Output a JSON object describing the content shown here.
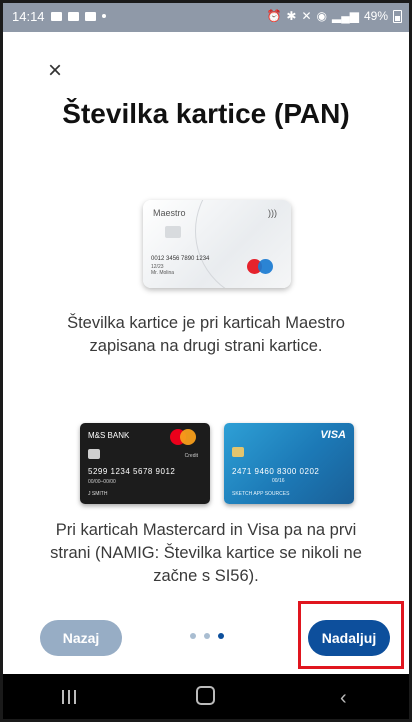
{
  "status_bar": {
    "time": "14:14",
    "battery": "49%"
  },
  "header": {
    "close_symbol": "×",
    "title": "Številka kartice (PAN)"
  },
  "maestro_card": {
    "brand": "Maestro",
    "number": "0012 3456 7890 1234",
    "expiry": "12/23",
    "holder": "Mr. Molina"
  },
  "text_maestro": "Številka kartice je pri karticah Maestro zapisana na drugi strani kartice.",
  "mastercard_card": {
    "bank": "M&S BANK",
    "tag": "Credit",
    "number": "5299 1234 5678 9012",
    "meta": "00/00–00/00",
    "holder": "J SMITH"
  },
  "visa_card": {
    "brand": "VISA",
    "number": "2471 9460 8300 0202",
    "expiry": "00/16",
    "holder": "SKETCH APP SOURCES"
  },
  "text_mc_visa": "Pri karticah Mastercard in Visa pa na prvi strani (NAMIG: Številka kartice se nikoli ne začne s SI56).",
  "buttons": {
    "back": "Nazaj",
    "next": "Nadaljuj"
  },
  "pager": {
    "total": 3,
    "current": 3
  },
  "colors": {
    "primary": "#0d4f9c",
    "secondary": "#97adc5",
    "highlight": "#e0151e"
  },
  "navbar": {
    "recent": "recent-apps-icon",
    "home": "home-icon",
    "back": "back-icon"
  }
}
